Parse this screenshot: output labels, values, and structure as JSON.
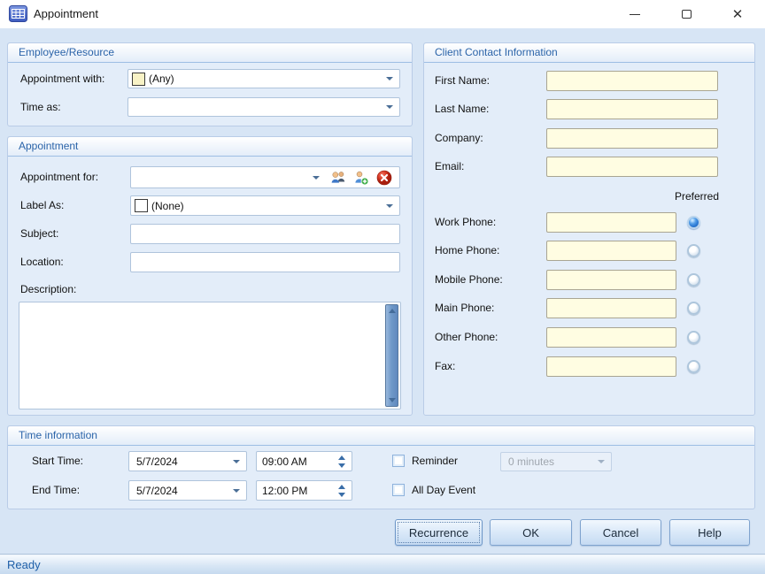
{
  "window": {
    "title": "Appointment"
  },
  "window_controls": {
    "minimize": "minimize",
    "maximize": "maximize",
    "close": "✕"
  },
  "employee_resource": {
    "title": "Employee/Resource",
    "appointment_with": {
      "label": "Appointment with:",
      "value": "(Any)"
    },
    "time_as": {
      "label": "Time as:",
      "value": ""
    }
  },
  "appointment": {
    "title": "Appointment",
    "appointment_for": {
      "label": "Appointment for:",
      "value": ""
    },
    "label_as": {
      "label": "Label As:",
      "value": "(None)"
    },
    "subject": {
      "label": "Subject:",
      "value": ""
    },
    "location": {
      "label": "Location:",
      "value": ""
    },
    "description": {
      "label": "Description:",
      "value": ""
    }
  },
  "client": {
    "title": "Client Contact Information",
    "fields": [
      {
        "label": "First Name:",
        "value": ""
      },
      {
        "label": "Last Name:",
        "value": ""
      },
      {
        "label": "Company:",
        "value": ""
      },
      {
        "label": "Email:",
        "value": ""
      }
    ],
    "preferred_label": "Preferred",
    "phones": [
      {
        "label": "Work Phone:",
        "value": "",
        "preferred": true
      },
      {
        "label": "Home Phone:",
        "value": "",
        "preferred": false
      },
      {
        "label": "Mobile Phone:",
        "value": "",
        "preferred": false
      },
      {
        "label": "Main Phone:",
        "value": "",
        "preferred": false
      },
      {
        "label": "Other Phone:",
        "value": "",
        "preferred": false
      },
      {
        "label": "Fax:",
        "value": "",
        "preferred": false
      }
    ]
  },
  "time_information": {
    "title": "Time information",
    "start": {
      "label": "Start Time:",
      "date": "5/7/2024",
      "time": "09:00 AM"
    },
    "end": {
      "label": "End Time:",
      "date": "5/7/2024",
      "time": "12:00 PM"
    },
    "reminder": {
      "label": "Reminder",
      "checked": false,
      "value": "0 minutes"
    },
    "all_day_event": {
      "label": "All Day Event",
      "checked": false
    }
  },
  "buttons": {
    "recurrence": "Recurrence",
    "ok": "OK",
    "cancel": "Cancel",
    "help": "Help"
  },
  "status_bar": {
    "text": "Ready"
  },
  "colors": {
    "accent_blue": "#2B64A9",
    "body_bg": "#D7E5F5",
    "group_bg": "#E3EDF9",
    "field_cream": "#FFFDE2",
    "scrollbar_blue": "#6D97C7",
    "radio_selected": "#2E7CD6"
  }
}
